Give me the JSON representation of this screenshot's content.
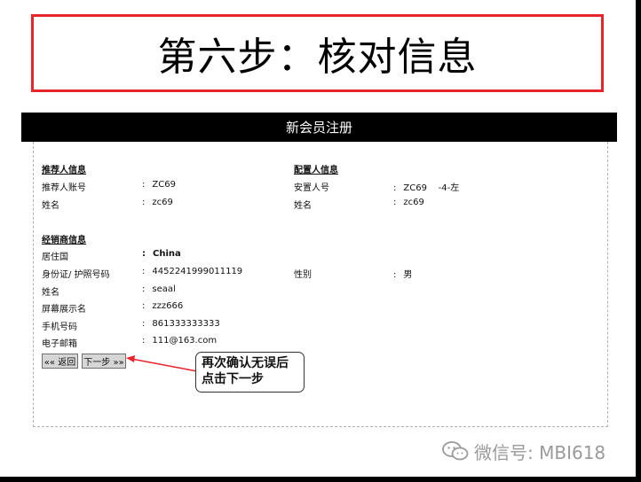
{
  "step_title": "第六步：核对信息",
  "header": {
    "title": "新会员注册"
  },
  "referrer": {
    "section_title": "推荐人信息",
    "account_label": "推荐人账号",
    "account_value": "ZC69",
    "name_label": "姓名",
    "name_value": "zc69"
  },
  "placement": {
    "section_title": "配置人信息",
    "placer_label": "安置人号",
    "placer_value": "ZC69    -4-左",
    "name_label": "姓名",
    "name_value": "zc69"
  },
  "dealer": {
    "section_title": "经销商信息",
    "country_label": "居住国",
    "country_value": "China",
    "id_label": "身份证/ 护照号码",
    "id_value": "4452241999011119",
    "gender_label": "性别",
    "gender_value": "男",
    "name_label": "姓名",
    "name_value": "seaal",
    "display_label": "屏幕展示名",
    "display_value": "zzz666",
    "phone_label": "手机号码",
    "phone_value": "861333333333",
    "email_label": "电子邮箱",
    "email_value": "111@163.com"
  },
  "buttons": {
    "back": "«« 返回",
    "next": "下一步 »»"
  },
  "callout": {
    "line1": "再次确认无误后",
    "line2": "点击下一步"
  },
  "watermark": {
    "text": "微信号: MBI618",
    "icon": "wechat-icon"
  },
  "colors": {
    "accent": "#e8252b",
    "header_bg": "#000000",
    "button_bg": "#d6d6d6"
  }
}
